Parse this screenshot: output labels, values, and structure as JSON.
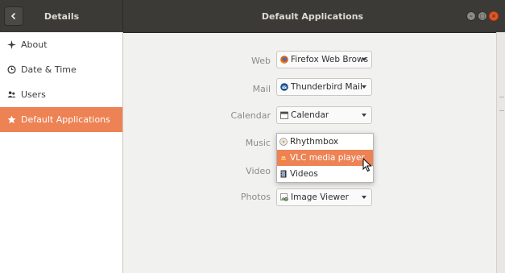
{
  "header": {
    "left_title": "Details",
    "main_title": "Default Applications",
    "window_buttons": [
      "minimize",
      "maximize",
      "close"
    ]
  },
  "sidebar": {
    "items": [
      {
        "label": "About",
        "icon": "plus-star-icon",
        "active": false
      },
      {
        "label": "Date & Time",
        "icon": "clock-icon",
        "active": false
      },
      {
        "label": "Users",
        "icon": "users-icon",
        "active": false
      },
      {
        "label": "Default Applications",
        "icon": "star-icon",
        "active": true
      }
    ]
  },
  "default_apps": {
    "rows": [
      {
        "label": "Web",
        "value": "Firefox Web Browser",
        "icon": "firefox-icon"
      },
      {
        "label": "Mail",
        "value": "Thunderbird Mail",
        "icon": "thunderbird-icon"
      },
      {
        "label": "Calendar",
        "value": "Calendar",
        "icon": "calendar-icon"
      },
      {
        "label": "Music",
        "value": "",
        "icon": ""
      },
      {
        "label": "Video",
        "value": "",
        "icon": ""
      },
      {
        "label": "Photos",
        "value": "Image Viewer",
        "icon": "image-viewer-icon"
      }
    ],
    "music_dropdown_open": true,
    "music_options": [
      {
        "label": "Rhythmbox",
        "icon": "rhythmbox-icon",
        "highlighted": false
      },
      {
        "label": "VLC media player",
        "icon": "vlc-icon",
        "highlighted": true
      },
      {
        "label": "Videos",
        "icon": "videos-icon",
        "highlighted": false
      }
    ]
  },
  "colors": {
    "accent": "#ed8254",
    "headerbar": "#3b3a36",
    "close_button": "#e95420"
  }
}
